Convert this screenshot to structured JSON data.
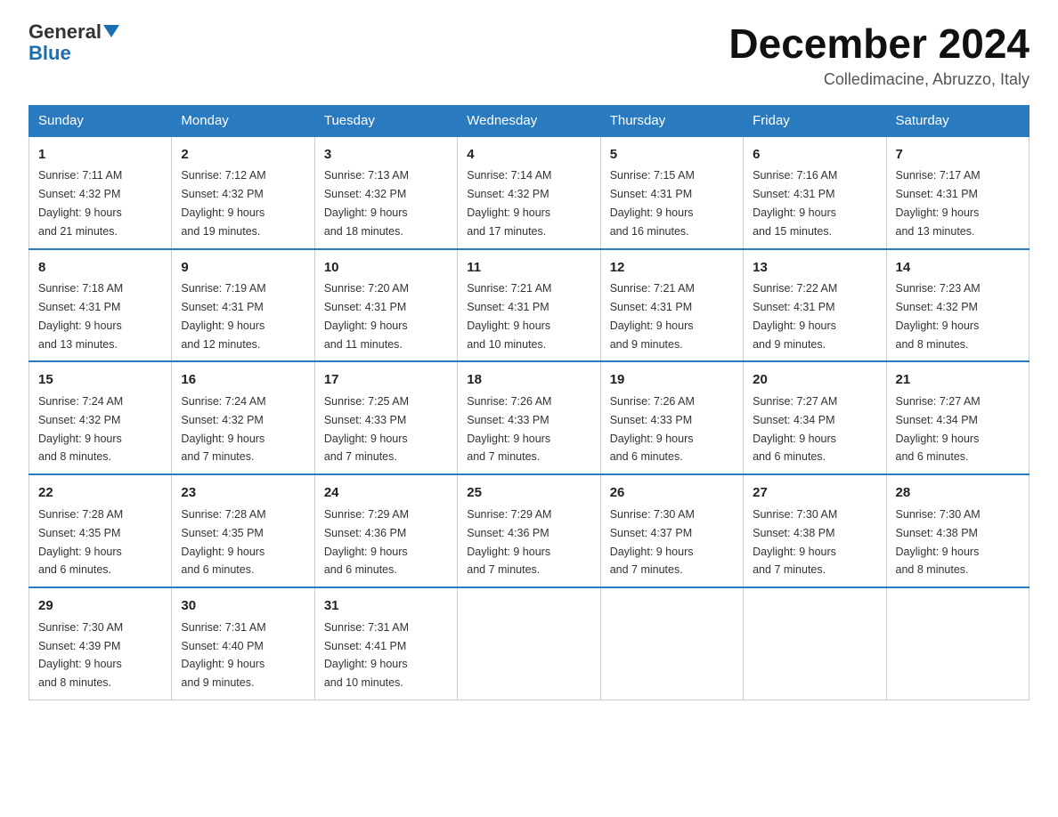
{
  "logo": {
    "line1": "General",
    "line2": "Blue"
  },
  "title": "December 2024",
  "subtitle": "Colledimacine, Abruzzo, Italy",
  "days_of_week": [
    "Sunday",
    "Monday",
    "Tuesday",
    "Wednesday",
    "Thursday",
    "Friday",
    "Saturday"
  ],
  "weeks": [
    [
      {
        "day": "1",
        "info": "Sunrise: 7:11 AM\nSunset: 4:32 PM\nDaylight: 9 hours\nand 21 minutes."
      },
      {
        "day": "2",
        "info": "Sunrise: 7:12 AM\nSunset: 4:32 PM\nDaylight: 9 hours\nand 19 minutes."
      },
      {
        "day": "3",
        "info": "Sunrise: 7:13 AM\nSunset: 4:32 PM\nDaylight: 9 hours\nand 18 minutes."
      },
      {
        "day": "4",
        "info": "Sunrise: 7:14 AM\nSunset: 4:32 PM\nDaylight: 9 hours\nand 17 minutes."
      },
      {
        "day": "5",
        "info": "Sunrise: 7:15 AM\nSunset: 4:31 PM\nDaylight: 9 hours\nand 16 minutes."
      },
      {
        "day": "6",
        "info": "Sunrise: 7:16 AM\nSunset: 4:31 PM\nDaylight: 9 hours\nand 15 minutes."
      },
      {
        "day": "7",
        "info": "Sunrise: 7:17 AM\nSunset: 4:31 PM\nDaylight: 9 hours\nand 13 minutes."
      }
    ],
    [
      {
        "day": "8",
        "info": "Sunrise: 7:18 AM\nSunset: 4:31 PM\nDaylight: 9 hours\nand 13 minutes."
      },
      {
        "day": "9",
        "info": "Sunrise: 7:19 AM\nSunset: 4:31 PM\nDaylight: 9 hours\nand 12 minutes."
      },
      {
        "day": "10",
        "info": "Sunrise: 7:20 AM\nSunset: 4:31 PM\nDaylight: 9 hours\nand 11 minutes."
      },
      {
        "day": "11",
        "info": "Sunrise: 7:21 AM\nSunset: 4:31 PM\nDaylight: 9 hours\nand 10 minutes."
      },
      {
        "day": "12",
        "info": "Sunrise: 7:21 AM\nSunset: 4:31 PM\nDaylight: 9 hours\nand 9 minutes."
      },
      {
        "day": "13",
        "info": "Sunrise: 7:22 AM\nSunset: 4:31 PM\nDaylight: 9 hours\nand 9 minutes."
      },
      {
        "day": "14",
        "info": "Sunrise: 7:23 AM\nSunset: 4:32 PM\nDaylight: 9 hours\nand 8 minutes."
      }
    ],
    [
      {
        "day": "15",
        "info": "Sunrise: 7:24 AM\nSunset: 4:32 PM\nDaylight: 9 hours\nand 8 minutes."
      },
      {
        "day": "16",
        "info": "Sunrise: 7:24 AM\nSunset: 4:32 PM\nDaylight: 9 hours\nand 7 minutes."
      },
      {
        "day": "17",
        "info": "Sunrise: 7:25 AM\nSunset: 4:33 PM\nDaylight: 9 hours\nand 7 minutes."
      },
      {
        "day": "18",
        "info": "Sunrise: 7:26 AM\nSunset: 4:33 PM\nDaylight: 9 hours\nand 7 minutes."
      },
      {
        "day": "19",
        "info": "Sunrise: 7:26 AM\nSunset: 4:33 PM\nDaylight: 9 hours\nand 6 minutes."
      },
      {
        "day": "20",
        "info": "Sunrise: 7:27 AM\nSunset: 4:34 PM\nDaylight: 9 hours\nand 6 minutes."
      },
      {
        "day": "21",
        "info": "Sunrise: 7:27 AM\nSunset: 4:34 PM\nDaylight: 9 hours\nand 6 minutes."
      }
    ],
    [
      {
        "day": "22",
        "info": "Sunrise: 7:28 AM\nSunset: 4:35 PM\nDaylight: 9 hours\nand 6 minutes."
      },
      {
        "day": "23",
        "info": "Sunrise: 7:28 AM\nSunset: 4:35 PM\nDaylight: 9 hours\nand 6 minutes."
      },
      {
        "day": "24",
        "info": "Sunrise: 7:29 AM\nSunset: 4:36 PM\nDaylight: 9 hours\nand 6 minutes."
      },
      {
        "day": "25",
        "info": "Sunrise: 7:29 AM\nSunset: 4:36 PM\nDaylight: 9 hours\nand 7 minutes."
      },
      {
        "day": "26",
        "info": "Sunrise: 7:30 AM\nSunset: 4:37 PM\nDaylight: 9 hours\nand 7 minutes."
      },
      {
        "day": "27",
        "info": "Sunrise: 7:30 AM\nSunset: 4:38 PM\nDaylight: 9 hours\nand 7 minutes."
      },
      {
        "day": "28",
        "info": "Sunrise: 7:30 AM\nSunset: 4:38 PM\nDaylight: 9 hours\nand 8 minutes."
      }
    ],
    [
      {
        "day": "29",
        "info": "Sunrise: 7:30 AM\nSunset: 4:39 PM\nDaylight: 9 hours\nand 8 minutes."
      },
      {
        "day": "30",
        "info": "Sunrise: 7:31 AM\nSunset: 4:40 PM\nDaylight: 9 hours\nand 9 minutes."
      },
      {
        "day": "31",
        "info": "Sunrise: 7:31 AM\nSunset: 4:41 PM\nDaylight: 9 hours\nand 10 minutes."
      },
      {
        "day": "",
        "info": ""
      },
      {
        "day": "",
        "info": ""
      },
      {
        "day": "",
        "info": ""
      },
      {
        "day": "",
        "info": ""
      }
    ]
  ]
}
